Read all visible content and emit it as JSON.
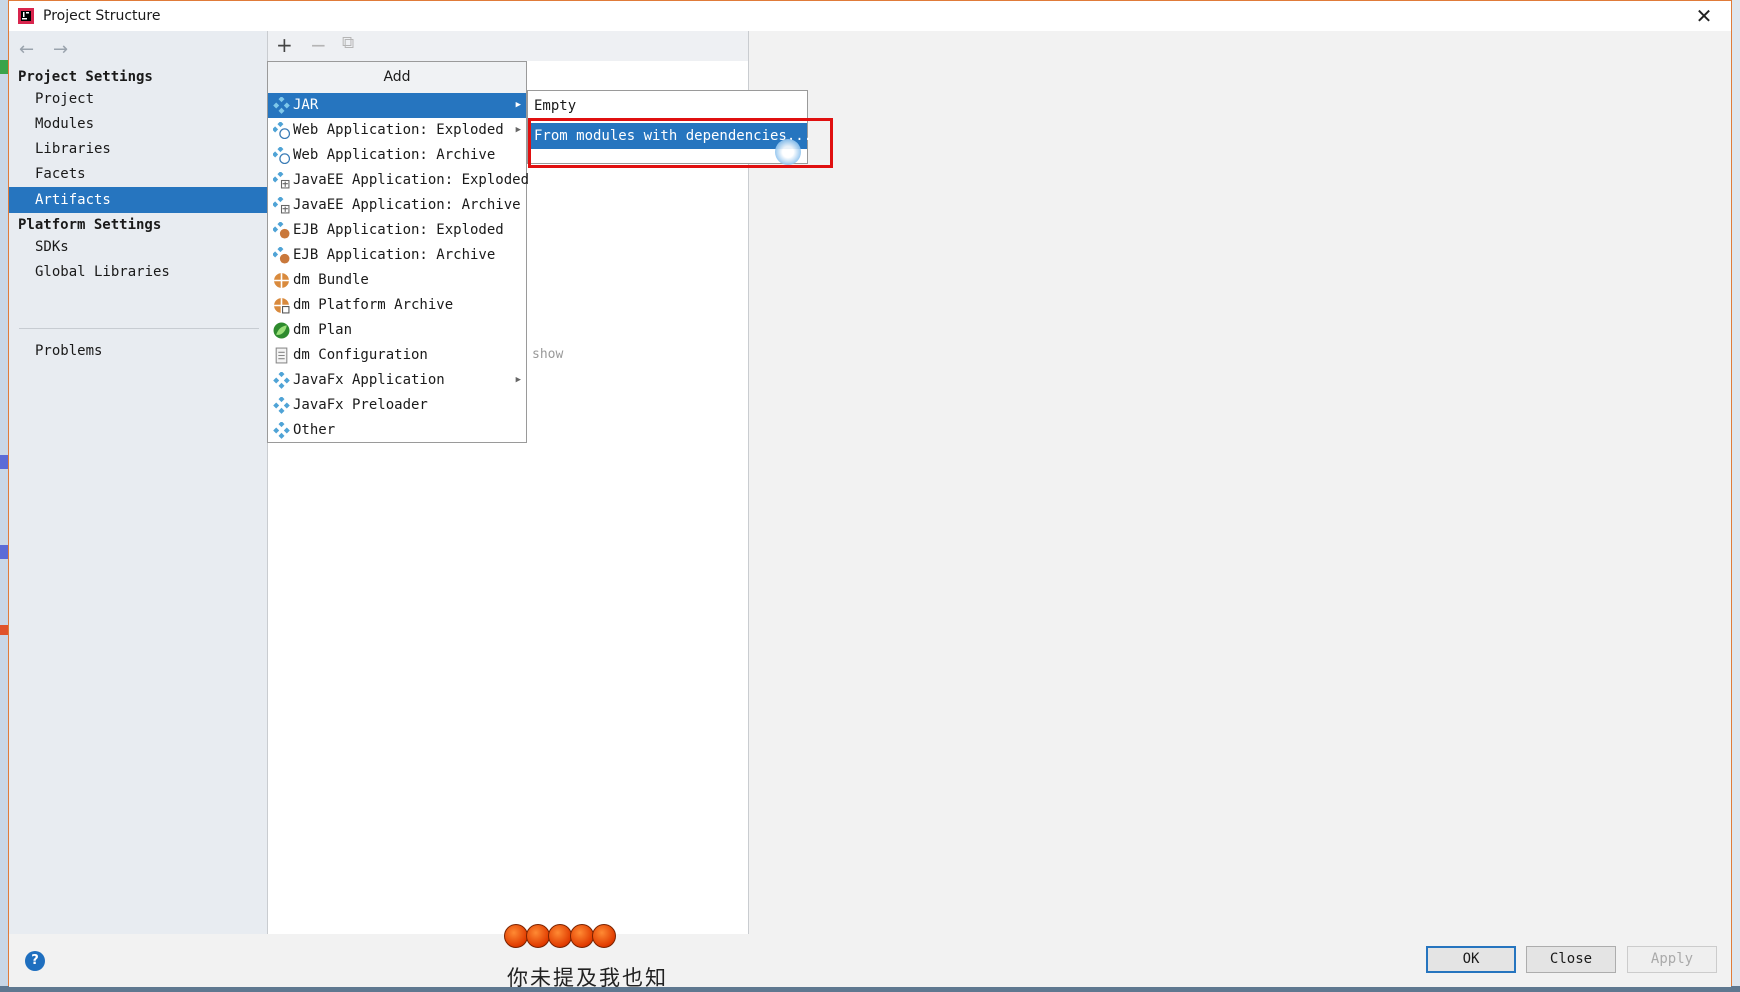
{
  "window": {
    "title": "Project Structure"
  },
  "sidebar": {
    "project_settings_header": "Project Settings",
    "project_items": [
      {
        "label": "Project"
      },
      {
        "label": "Modules"
      },
      {
        "label": "Libraries"
      },
      {
        "label": "Facets"
      },
      {
        "label": "Artifacts",
        "selected": true
      }
    ],
    "platform_settings_header": "Platform Settings",
    "platform_items": [
      {
        "label": "SDKs"
      },
      {
        "label": "Global Libraries"
      }
    ],
    "problems_label": "Problems"
  },
  "toolbar": {
    "add": "+",
    "remove": "−",
    "copy": "⧉"
  },
  "middle": {
    "hint": "show"
  },
  "add_menu": {
    "header": "Add",
    "items": [
      {
        "label": "JAR",
        "icon": "jar-icon",
        "submenu": true,
        "active": true
      },
      {
        "label": "Web Application: Exploded",
        "icon": "web-app-icon",
        "submenu": true
      },
      {
        "label": "Web Application: Archive",
        "icon": "web-app-icon"
      },
      {
        "label": "JavaEE Application: Exploded",
        "icon": "javaee-icon"
      },
      {
        "label": "JavaEE Application: Archive",
        "icon": "javaee-icon"
      },
      {
        "label": "EJB Application: Exploded",
        "icon": "ejb-icon"
      },
      {
        "label": "EJB Application: Archive",
        "icon": "ejb-icon"
      },
      {
        "label": "dm Bundle",
        "icon": "dm-bundle-icon"
      },
      {
        "label": "dm Platform Archive",
        "icon": "dm-bundle-icon"
      },
      {
        "label": "dm Plan",
        "icon": "dm-plan-icon"
      },
      {
        "label": "dm Configuration",
        "icon": "config-file-icon"
      },
      {
        "label": "JavaFx Application",
        "icon": "javafx-icon",
        "submenu": true
      },
      {
        "label": "JavaFx Preloader",
        "icon": "javafx-icon"
      },
      {
        "label": "Other",
        "icon": "other-icon"
      }
    ]
  },
  "jar_submenu": {
    "items": [
      {
        "label": "Empty"
      },
      {
        "label": "From modules with dependencies...",
        "active": true
      }
    ]
  },
  "footer": {
    "help": "?",
    "ok": "OK",
    "close": "Close",
    "apply": "Apply"
  },
  "overlay": {
    "subtitle": "你未提及我也知"
  },
  "colors": {
    "selection": "#2675bf",
    "highlight_box": "#e01010"
  }
}
